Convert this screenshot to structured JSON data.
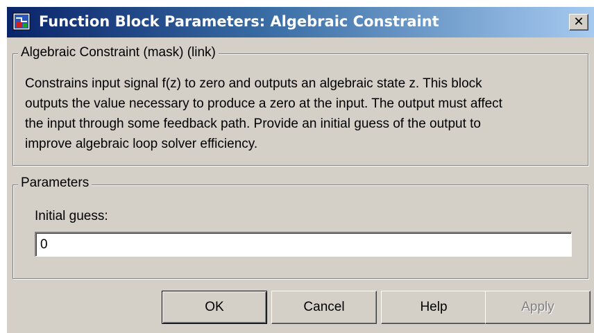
{
  "window": {
    "title": "Function Block Parameters: Algebraic Constraint",
    "close_glyph": "✕",
    "title_icon": "simulink-block-icon",
    "colors": {
      "titlebar_start": "#0a246a",
      "titlebar_end": "#a6caf0",
      "face": "#d4d0c8"
    }
  },
  "description_group": {
    "legend": "Algebraic Constraint (mask) (link)",
    "lines": [
      "Constrains input signal f(z) to zero and outputs an algebraic state z. This block",
      "outputs the value necessary to produce a zero at the input. The output must affect",
      "the input through some feedback path. Provide an initial guess of the output to",
      "improve algebraic loop solver efficiency."
    ]
  },
  "parameters_group": {
    "legend": "Parameters",
    "initial_guess_label": "Initial guess:",
    "initial_guess_value": "0"
  },
  "buttons": {
    "ok": "OK",
    "cancel": "Cancel",
    "help": "Help",
    "apply": "Apply",
    "apply_enabled": false
  }
}
